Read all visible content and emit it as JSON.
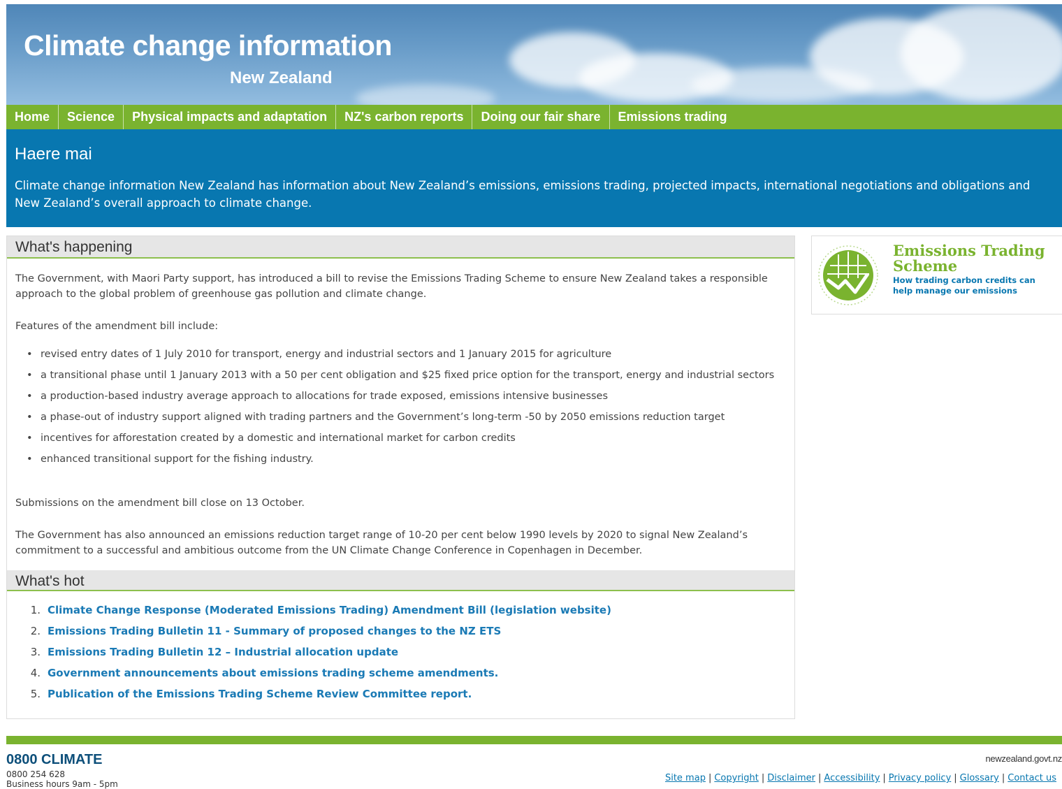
{
  "header": {
    "title": "Climate change information",
    "subtitle": "New Zealand"
  },
  "nav": {
    "items": [
      {
        "label": "Home"
      },
      {
        "label": "Science"
      },
      {
        "label": "Physical impacts and adaptation"
      },
      {
        "label": "NZ's carbon reports"
      },
      {
        "label": "Doing our fair share"
      },
      {
        "label": "Emissions trading"
      }
    ]
  },
  "intro": {
    "heading": "Haere mai",
    "text": "Climate change information New Zealand has information about New Zealand’s emissions, emissions trading, projected impacts, international negotiations and obligations and New Zealand’s overall approach to climate change."
  },
  "whats_happening": {
    "heading": "What's happening",
    "para1": "The Government, with Maori Party support, has introduced a bill to revise the Emissions Trading Scheme to ensure New Zealand takes a responsible approach to the global problem of greenhouse gas pollution and climate change.",
    "para2": "Features of the amendment bill include:",
    "bullets": [
      "revised entry dates of 1 July 2010 for transport, energy and industrial sectors and 1 January 2015 for agriculture",
      "a transitional phase until 1 January 2013 with a 50 per cent obligation and $25 fixed price option for the transport, energy and industrial sectors",
      "a production-based industry average approach to allocations for trade exposed, emissions intensive businesses",
      "a phase-out of industry support aligned with trading partners and the Government’s long-term -50 by 2050 emissions reduction target",
      "incentives for afforestation created by a domestic and international market for carbon credits",
      "enhanced transitional support for the fishing industry."
    ],
    "para3": "Submissions on the amendment bill close on 13 October.",
    "para4": "The Government has also announced an emissions reduction target range of 10-20 per cent below 1990 levels by 2020 to signal New Zealand’s commitment to a successful and ambitious outcome from the UN Climate Change Conference in Copenhagen in December."
  },
  "whats_hot": {
    "heading": "What's hot",
    "items": [
      {
        "num": "1.",
        "label": "Climate Change Response (Moderated Emissions Trading) Amendment Bill (legislation website)"
      },
      {
        "num": "2.",
        "label": "Emissions Trading Bulletin 11 - Summary of proposed changes to the NZ ETS"
      },
      {
        "num": "3.",
        "label": "Emissions Trading Bulletin 12 – Industrial allocation update"
      },
      {
        "num": "4.",
        "label": "Government announcements about emissions trading scheme amendments."
      },
      {
        "num": "5.",
        "label": "Publication of the Emissions Trading Scheme Review Committee report."
      }
    ]
  },
  "ets_promo": {
    "title_line1": "Emissions Trading",
    "title_line2": "Scheme",
    "desc_line1": "How trading carbon credits can",
    "desc_line2": "help manage our emissions",
    "icon": "ets-globe-chart-icon"
  },
  "footer": {
    "phone_title": "0800 CLIMATE",
    "phone_number": "0800 254 628",
    "hours": "Business hours 9am - 5pm",
    "govt_logo_text": "newzealand.govt.nz",
    "links": [
      {
        "label": "Site map"
      },
      {
        "label": "Copyright"
      },
      {
        "label": "Disclaimer"
      },
      {
        "label": "Accessibility"
      },
      {
        "label": "Privacy policy"
      },
      {
        "label": "Glossary"
      },
      {
        "label": "Contact us"
      }
    ]
  },
  "colors": {
    "nav_green": "#7ab32f",
    "intro_blue": "#0877b0",
    "link_blue": "#1a7ab5"
  }
}
